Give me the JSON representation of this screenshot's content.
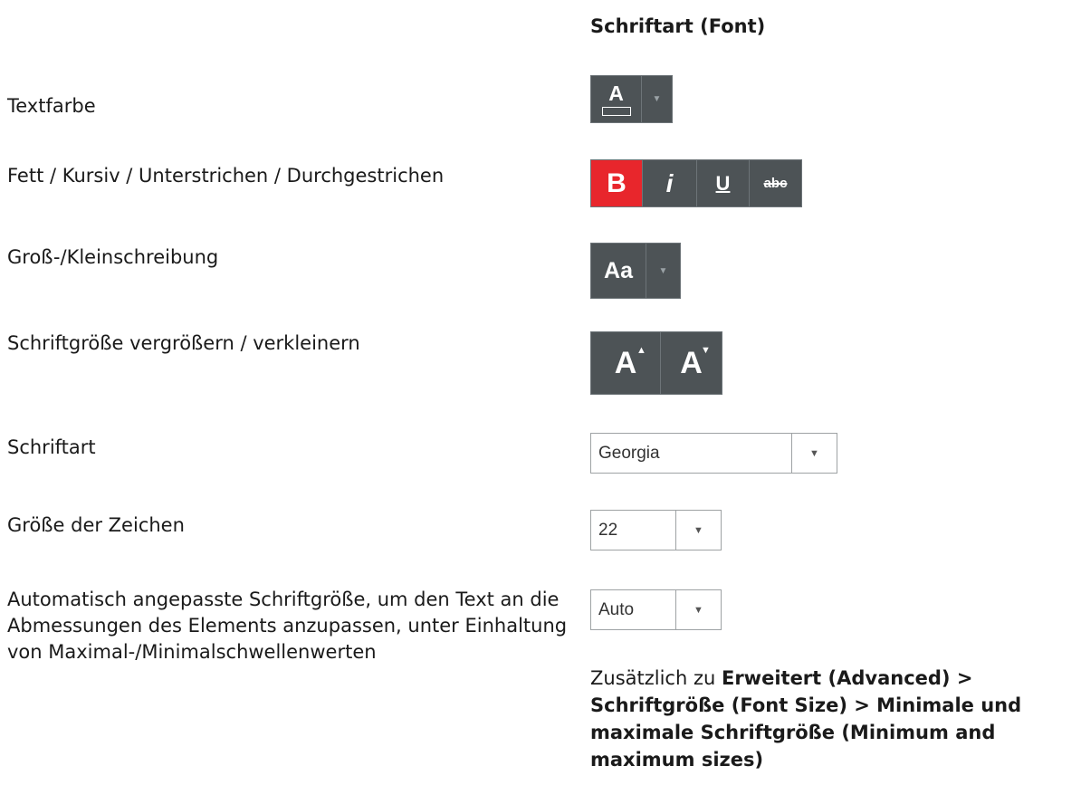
{
  "header": "Schriftart (Font)",
  "rows": [
    {
      "label": "Textfarbe"
    },
    {
      "label": "Fett / Kursiv / Unterstrichen / Durchgestrichen"
    },
    {
      "label": "Groß-/Kleinschreibung"
    },
    {
      "label": "Schriftgröße vergrößern / verkleinern"
    },
    {
      "label": "Schriftart"
    },
    {
      "label": "Größe der Zeichen"
    },
    {
      "label": "Automatisch angepasste Schriftgröße, um den Text an die Abmessungen des Elements anzupassen, unter Einhaltung von Maximal-/Minimalschwellenwerten"
    }
  ],
  "controls": {
    "text_color_glyph": "A",
    "bold": "B",
    "italic": "i",
    "underline": "U",
    "strike": "abc",
    "case": "Aa",
    "grow": "A",
    "shrink": "A",
    "font_family": "Georgia",
    "font_size": "22",
    "autofit": "Auto"
  },
  "note": {
    "prefix": "Zusätzlich zu ",
    "path": "Erweitert (Advanced) > Schriftgröße (Font Size)  > Minimale und maximale Schriftgröße (Minimum and maximum sizes)"
  },
  "colors": {
    "toolbar_bg": "#4d5356",
    "active": "#e8262c"
  }
}
